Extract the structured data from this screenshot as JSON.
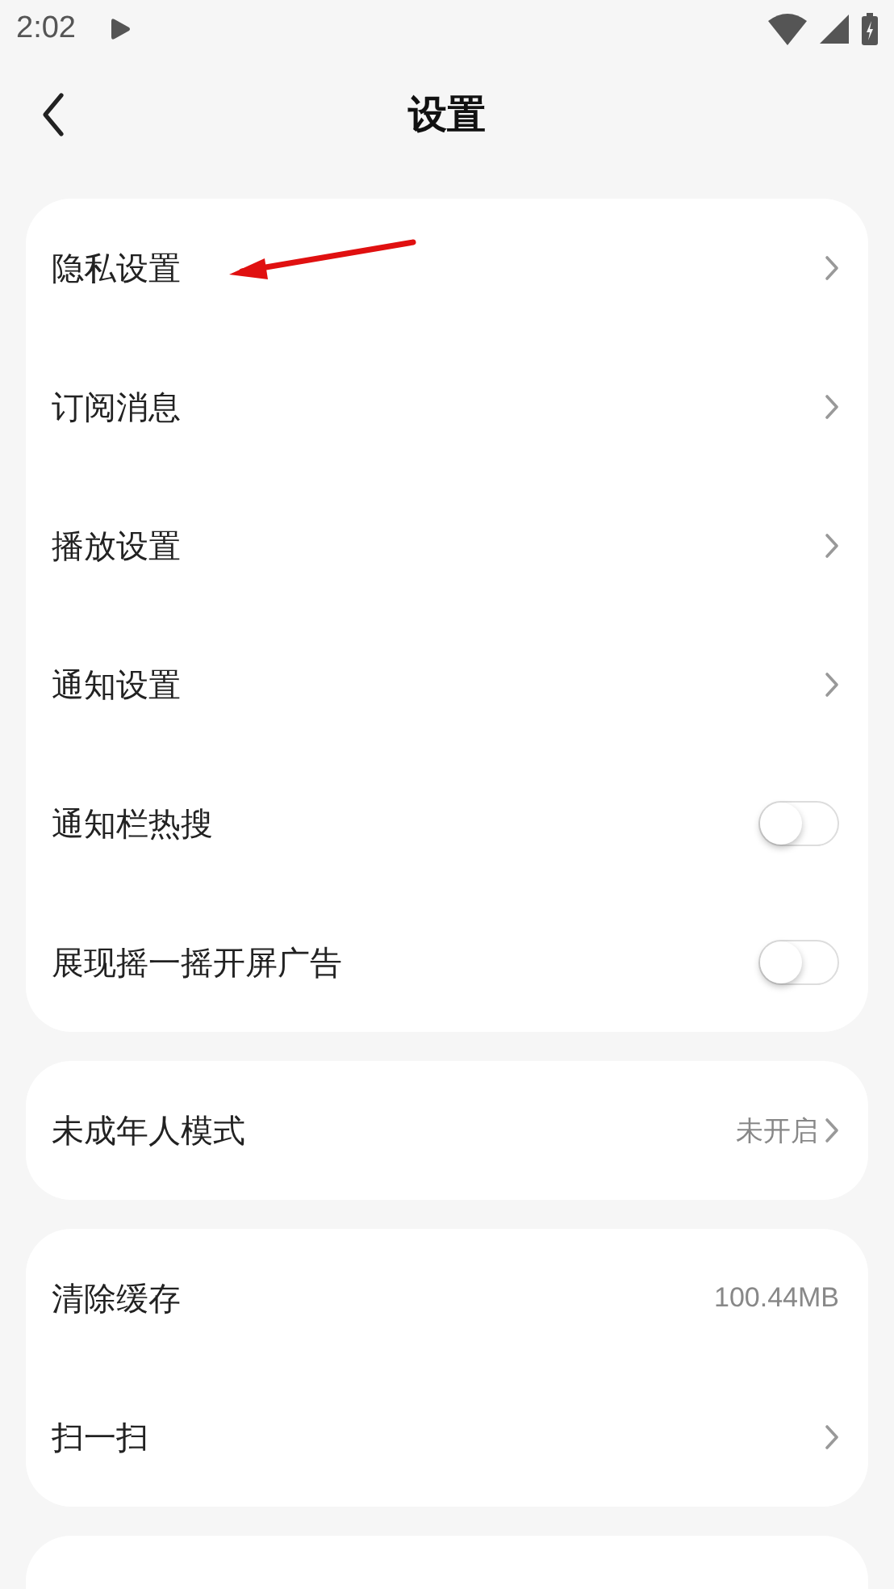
{
  "status_bar": {
    "time": "2:02"
  },
  "header": {
    "title": "设置"
  },
  "groups": [
    {
      "items": [
        {
          "kind": "link",
          "label": "隐私设置"
        },
        {
          "kind": "link",
          "label": "订阅消息"
        },
        {
          "kind": "link",
          "label": "播放设置"
        },
        {
          "kind": "link",
          "label": "通知设置"
        },
        {
          "kind": "toggle",
          "label": "通知栏热搜",
          "on": false
        },
        {
          "kind": "toggle",
          "label": "展现摇一摇开屏广告",
          "on": false
        }
      ]
    },
    {
      "items": [
        {
          "kind": "value",
          "label": "未成年人模式",
          "value": "未开启",
          "chevron": true
        }
      ]
    },
    {
      "items": [
        {
          "kind": "value",
          "label": "清除缓存",
          "value": "100.44MB",
          "chevron": false
        },
        {
          "kind": "link",
          "label": "扫一扫"
        }
      ]
    }
  ],
  "trailing_card": true,
  "pointer_arrow": true
}
